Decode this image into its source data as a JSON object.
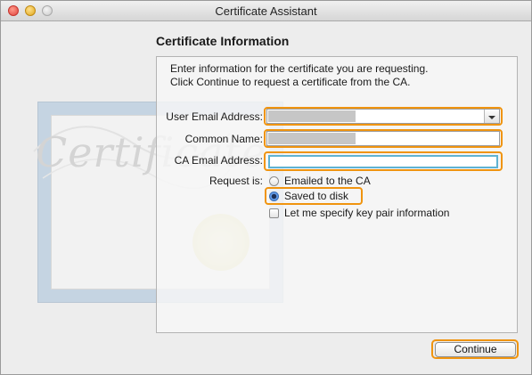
{
  "window": {
    "title": "Certificate Assistant"
  },
  "page": {
    "heading": "Certificate Information",
    "intro_line1": "Enter information for the certificate you are requesting.",
    "intro_line2": "Click Continue to request a certificate from the CA."
  },
  "form": {
    "user_email_label": "User Email Address:",
    "user_email_value": "",
    "common_name_label": "Common Name:",
    "common_name_value": "",
    "ca_email_label": "CA Email Address:",
    "ca_email_value": "",
    "request_label": "Request is:",
    "options": [
      {
        "label": "Emailed to the CA",
        "selected": false
      },
      {
        "label": "Saved to disk",
        "selected": true
      }
    ],
    "key_pair_label": "Let me specify key pair information",
    "key_pair_checked": false
  },
  "artwork": {
    "script_text": "Certificate"
  },
  "buttons": {
    "continue_label": "Continue"
  },
  "colors": {
    "highlight": "#f0940f",
    "panel_bg": "#f6f6f6",
    "window_bg": "#ededed"
  }
}
